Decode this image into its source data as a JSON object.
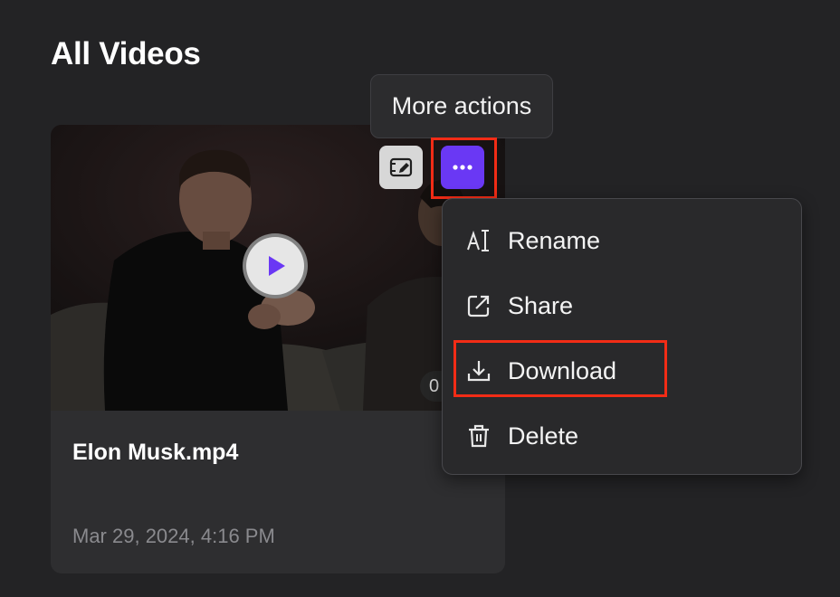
{
  "page": {
    "title": "All Videos"
  },
  "video": {
    "name": "Elon Musk.mp4",
    "date": "Mar 29, 2024, 4:16 PM",
    "duration_visible": "0"
  },
  "tooltip": {
    "text": "More actions"
  },
  "menu": {
    "items": [
      {
        "label": "Rename",
        "icon": "rename-icon"
      },
      {
        "label": "Share",
        "icon": "share-icon"
      },
      {
        "label": "Download",
        "icon": "download-icon"
      },
      {
        "label": "Delete",
        "icon": "trash-icon"
      }
    ]
  },
  "colors": {
    "background": "#232325",
    "card": "#2e2e30",
    "accent": "#6a38f4",
    "highlight": "#f22c16"
  }
}
